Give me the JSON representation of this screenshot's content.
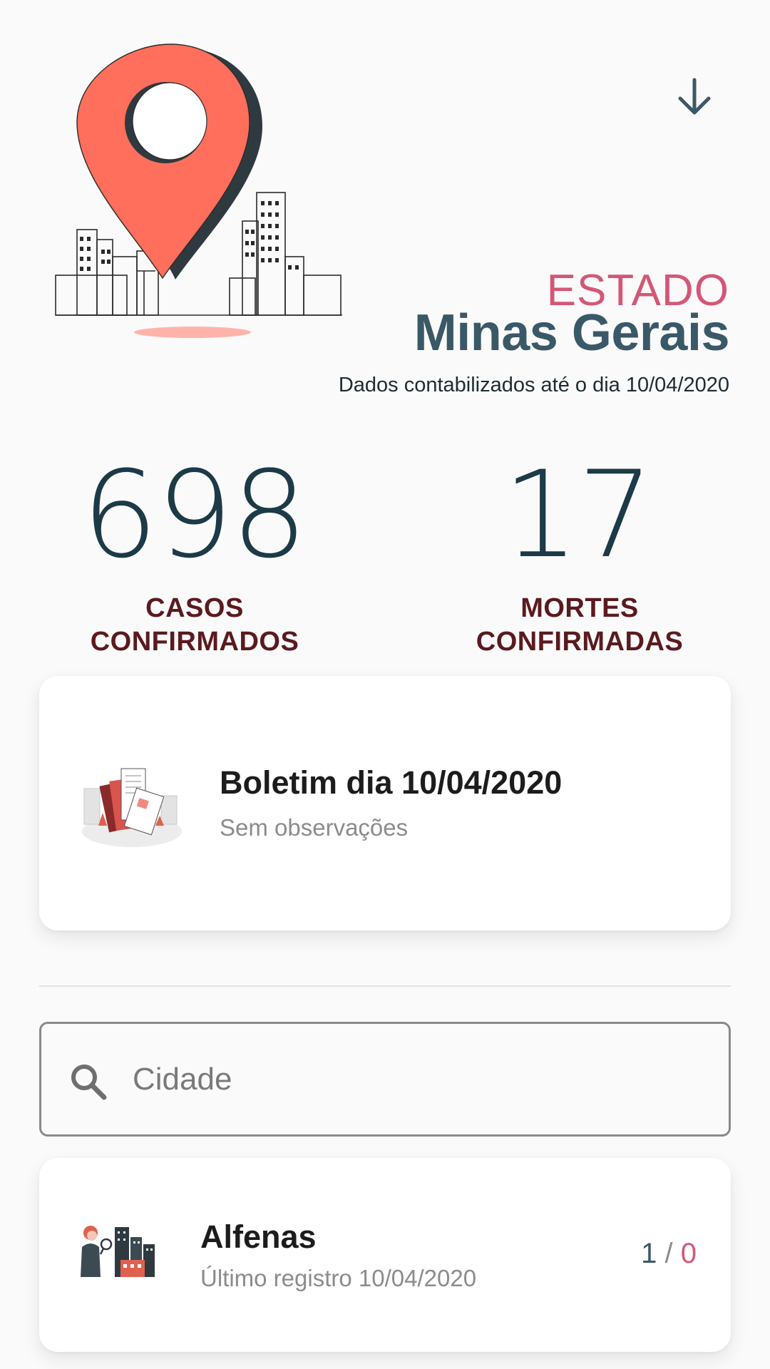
{
  "header": {
    "kicker": "ESTADO",
    "state_name": "Minas Gerais",
    "updated_note": "Dados contabilizados até o dia 10/04/2020",
    "download_icon": "arrow-down-icon"
  },
  "stats": {
    "cases_value": "698",
    "cases_label_line1": "CASOS",
    "cases_label_line2": "CONFIRMADOS",
    "deaths_value": "17",
    "deaths_label_line1": "MORTES",
    "deaths_label_line2": "CONFIRMADAS"
  },
  "bulletin": {
    "title": "Boletim dia 10/04/2020",
    "subtitle": "Sem observações"
  },
  "search": {
    "placeholder": "Cidade",
    "icon": "search-icon"
  },
  "cities": [
    {
      "name": "Alfenas",
      "subtitle": "Último registro 10/04/2020",
      "cases": "1",
      "separator": " / ",
      "deaths": "0"
    }
  ],
  "colors": {
    "accent_pink": "#d45776",
    "state_blue": "#3a5968",
    "label_maroon": "#5b1a1f",
    "pin_coral": "#ff6f5b",
    "background": "#fafafa"
  }
}
